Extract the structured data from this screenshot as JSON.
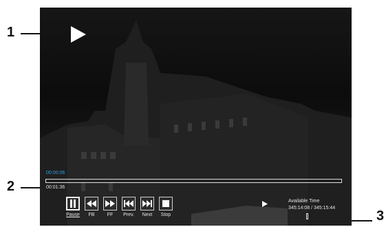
{
  "callouts": {
    "one": "1",
    "two": "2",
    "three": "3"
  },
  "player": {
    "elapsed_time": "00:00:06",
    "remaining_time": "00:01:36",
    "available_time_label": "Available Time",
    "available_time_value": "345:14:08 / 345:15:44",
    "controls": [
      {
        "label": "Pause",
        "icon": "pause-icon",
        "active": true
      },
      {
        "label": "FB",
        "icon": "fast-backward-icon"
      },
      {
        "label": "FF",
        "icon": "fast-forward-icon"
      },
      {
        "label": "Prev.",
        "icon": "previous-icon"
      },
      {
        "label": "Next",
        "icon": "next-icon"
      },
      {
        "label": "Stop",
        "icon": "stop-icon"
      }
    ]
  },
  "colors": {
    "elapsed_accent": "#2aa0e0",
    "screen_bg": "#111111"
  }
}
